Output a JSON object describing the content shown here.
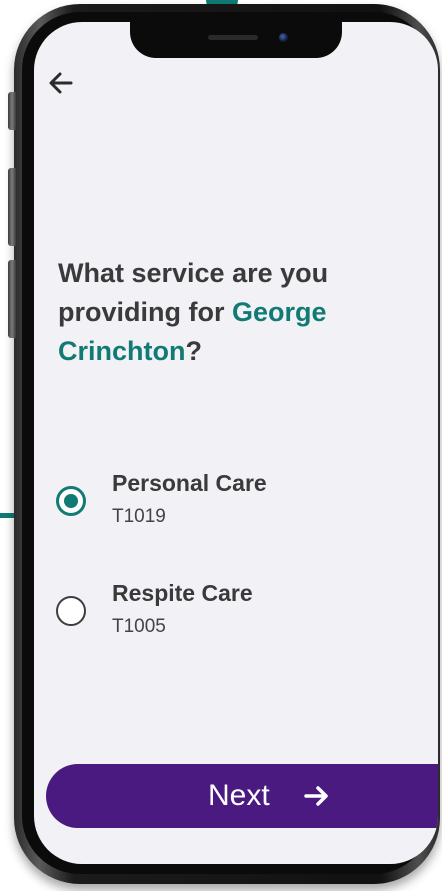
{
  "screen": {
    "back_icon": "arrow-left-icon",
    "question": {
      "prefix": "What service are you providing for ",
      "client_name": "George Crinchton",
      "suffix": "?"
    },
    "options": [
      {
        "title": "Personal Care",
        "code": "T1019",
        "selected": true
      },
      {
        "title": "Respite Care",
        "code": "T1005",
        "selected": false
      }
    ],
    "next_button": {
      "label": "Next",
      "icon": "arrow-right-icon"
    }
  },
  "colors": {
    "accent_teal": "#117a74",
    "button_purple": "#4b1a80",
    "screen_background": "#f1f1f6",
    "text_dark": "#3a3a3a"
  }
}
